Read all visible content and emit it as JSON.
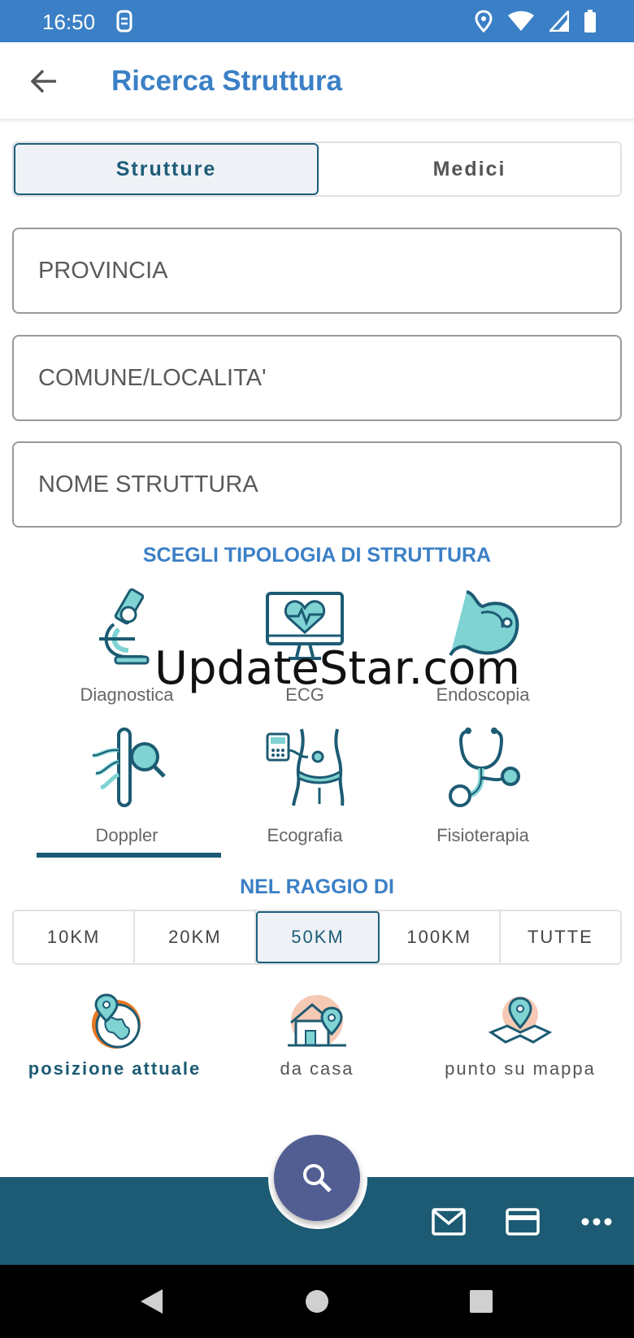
{
  "status_bar": {
    "time": "16:50"
  },
  "app_bar": {
    "title": "Ricerca Struttura"
  },
  "segments": [
    {
      "label": "Strutture",
      "active": true
    },
    {
      "label": "Medici",
      "active": false
    }
  ],
  "fields": {
    "provincia": {
      "value": "",
      "placeholder": "PROVINCIA"
    },
    "comune": {
      "value": "",
      "placeholder": "COMUNE/LOCALITA'"
    },
    "nome": {
      "value": "",
      "placeholder": "NOME STRUTTURA"
    }
  },
  "type_section_title": "SCEGLI TIPOLOGIA DI STRUTTURA",
  "types": [
    {
      "label": "Diagnostica",
      "icon": "microscope-icon"
    },
    {
      "label": "ECG",
      "icon": "monitor-heart-icon"
    },
    {
      "label": "Endoscopia",
      "icon": "stomach-icon"
    },
    {
      "label": "Doppler",
      "icon": "vessel-search-icon",
      "selected": true
    },
    {
      "label": "Ecografia",
      "icon": "ultrasound-icon"
    },
    {
      "label": "Fisioterapia",
      "icon": "stethoscope-icon"
    }
  ],
  "watermark": "UpdateStar.com",
  "radius_section_title": "NEL RAGGIO DI",
  "radius_options": [
    {
      "label": "10KM",
      "active": false
    },
    {
      "label": "20KM",
      "active": false
    },
    {
      "label": "50KM",
      "active": true
    },
    {
      "label": "100KM",
      "active": false
    },
    {
      "label": "TUTTE",
      "active": false
    }
  ],
  "location_options": [
    {
      "label": "posizione attuale",
      "icon": "globe-pin-icon",
      "active": true
    },
    {
      "label": "da casa",
      "icon": "home-pin-icon",
      "active": false
    },
    {
      "label": "punto su mappa",
      "icon": "map-pin-icon",
      "active": false
    }
  ],
  "colors": {
    "primary": "#3b80c6",
    "dark": "#1c5b73",
    "fab": "#525e92",
    "accent": "#e87722",
    "icon_fill": "#7fd3d3"
  }
}
